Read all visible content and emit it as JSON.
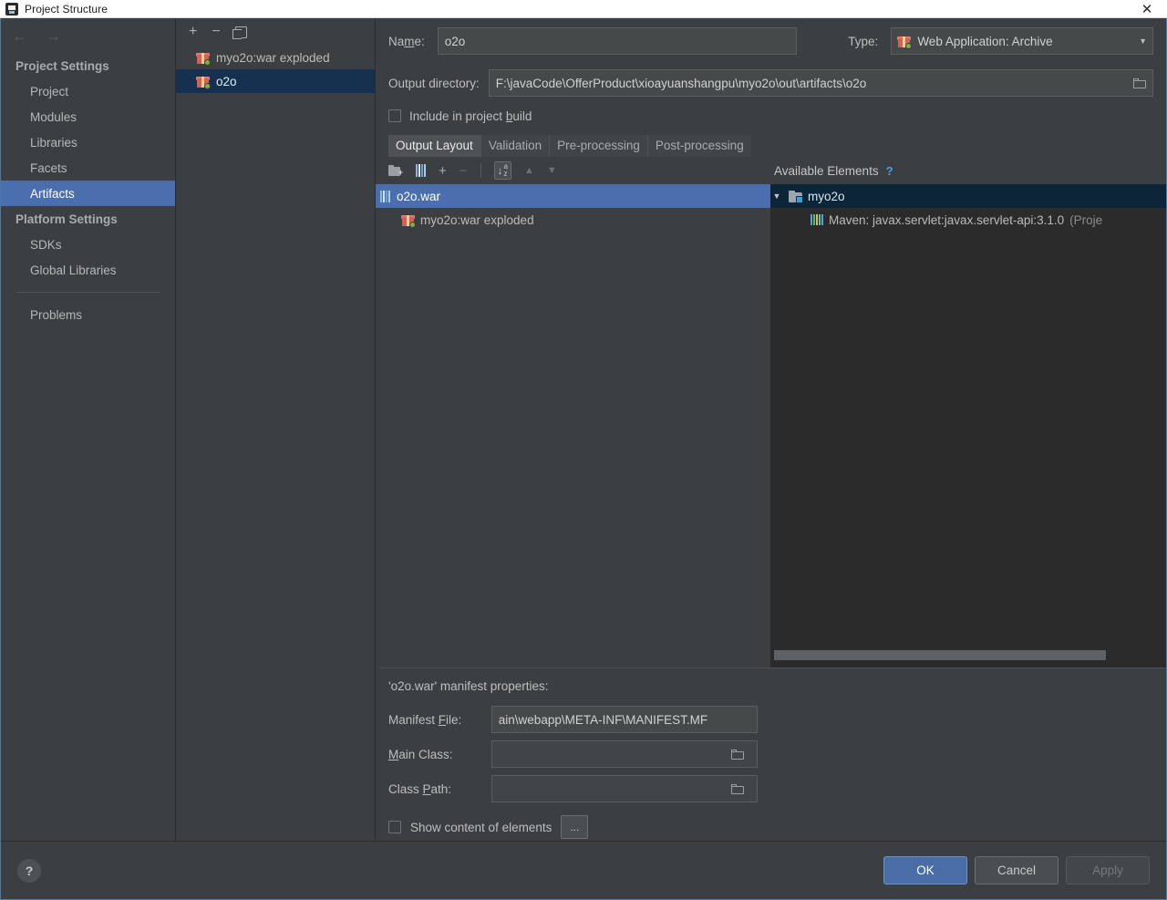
{
  "window": {
    "title": "Project Structure",
    "app_icon": "intellij-idea-icon",
    "close_label": "✕"
  },
  "nav": {
    "back": "←",
    "forward": "→"
  },
  "sidebar": {
    "groups": [
      {
        "label": "Project Settings",
        "items": [
          {
            "label": "Project",
            "selected": false
          },
          {
            "label": "Modules",
            "selected": false
          },
          {
            "label": "Libraries",
            "selected": false
          },
          {
            "label": "Facets",
            "selected": false
          },
          {
            "label": "Artifacts",
            "selected": true
          }
        ]
      },
      {
        "label": "Platform Settings",
        "items": [
          {
            "label": "SDKs",
            "selected": false
          },
          {
            "label": "Global Libraries",
            "selected": false
          }
        ]
      }
    ],
    "problems": "Problems"
  },
  "artifacts_panel": {
    "toolbar": {
      "add": "+",
      "remove": "−",
      "copy": "copy-icon"
    },
    "items": [
      {
        "label": "myo2o:war exploded",
        "icon": "package-icon",
        "selected": false
      },
      {
        "label": "o2o",
        "icon": "package-icon",
        "selected": true
      }
    ]
  },
  "editor": {
    "name_label_pre": "Na",
    "name_label_mnemonic": "m",
    "name_label_post": "e:",
    "name_value": "o2o",
    "type_label": "Type:",
    "type_value": "Web Application: Archive",
    "type_icon": "package-icon",
    "type_caret": "▼",
    "output_dir_label": "Output directory:",
    "output_dir_value": "F:\\javaCode\\OfferProduct\\xioayuanshangpu\\myo2o\\out\\artifacts\\o2o",
    "output_dir_browse_icon": "folder-icon",
    "include_checkbox": {
      "checked": false,
      "label_pre": "Include in project ",
      "label_mnemonic": "b",
      "label_post": "uild"
    },
    "tabs": [
      {
        "label": "Output Layout",
        "active": true
      },
      {
        "label": "Validation",
        "active": false
      },
      {
        "label": "Pre-processing",
        "active": false
      },
      {
        "label": "Post-processing",
        "active": false
      }
    ],
    "tree_toolbar": {
      "add_directory": "folder-plus-icon",
      "add_archive": "archive-icon",
      "add": "+",
      "remove": "−",
      "sort": "sort-alpha-icon",
      "move_up": "▲",
      "move_down": "▼"
    },
    "output_tree": [
      {
        "label": "o2o.war",
        "icon": "archive-icon",
        "indent": 0,
        "selected": true
      },
      {
        "label": "myo2o:war exploded",
        "icon": "package-icon",
        "indent": 1,
        "selected": false
      }
    ],
    "available": {
      "header": "Available Elements",
      "help": "?",
      "tree": [
        {
          "label": "myo2o",
          "icon": "module-icon",
          "indent": 0,
          "expander": "▼",
          "selected": true
        },
        {
          "label": "Maven: javax.servlet:javax.servlet-api:3.1.0",
          "suffix": " (Proje",
          "icon": "library-icon",
          "indent": 1,
          "expander": "",
          "selected": false
        }
      ]
    },
    "manifest": {
      "title": "'o2o.war' manifest properties:",
      "rows": [
        {
          "label_pre": "Manifest ",
          "label_mnemonic": "F",
          "label_post": "ile:",
          "value": "ain\\webapp\\META-INF\\MANIFEST.MF",
          "has_browse": false
        },
        {
          "label_pre": "",
          "label_mnemonic": "M",
          "label_post": "ain Class:",
          "value": "",
          "has_browse": true
        },
        {
          "label_pre": "Class ",
          "label_mnemonic": "P",
          "label_post": "ath:",
          "value": "",
          "has_browse": true
        }
      ],
      "show_content": {
        "checked": false,
        "label": "Show content of elements",
        "ellipsis": "..."
      }
    }
  },
  "footer": {
    "help": "?",
    "ok": "OK",
    "cancel": "Cancel",
    "apply": "Apply"
  },
  "colors": {
    "background": "#3c3f41",
    "selection_blue": "#4b6eaf",
    "selection_navy": "#0d2538",
    "tree_background": "#2b2b2b",
    "primary_button": "#4a6da7",
    "accent_link": "#5b9bd5"
  }
}
